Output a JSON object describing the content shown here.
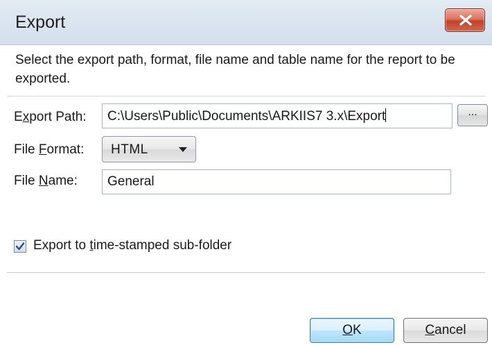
{
  "dialog": {
    "title": "Export",
    "close_icon": "close-x-icon"
  },
  "description": "Select the export path, format, file name and table name for the report to be exported.",
  "fields": {
    "export_path": {
      "label_pre": "E",
      "label_mnemonic": "x",
      "label_post": "port Path:",
      "value": "C:\\Users\\Public\\Documents\\ARKIIS7 3.x\\Export"
    },
    "browse_label": "...",
    "file_format": {
      "label_pre": "File ",
      "label_mnemonic": "F",
      "label_post": "ormat:",
      "selected": "HTML",
      "arrow_icon": "dropdown-arrow-icon"
    },
    "file_name": {
      "label_pre": "File ",
      "label_mnemonic": "N",
      "label_post": "ame:",
      "value": "General"
    }
  },
  "option": {
    "checked": true,
    "label_pre": "Export to ",
    "label_mnemonic": "t",
    "label_post": "ime-stamped sub-folder",
    "check_icon": "checkmark-icon"
  },
  "buttons": {
    "ok": {
      "mnemonic": "O",
      "rest": "K"
    },
    "cancel": {
      "mnemonic": "C",
      "rest": "ancel"
    }
  }
}
